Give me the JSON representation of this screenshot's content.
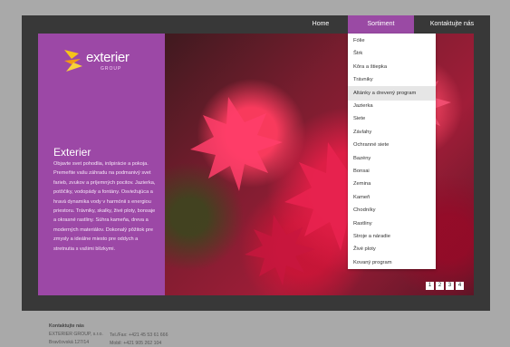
{
  "nav": {
    "home": "Home",
    "sortiment": "Sortiment",
    "kontakt": "Kontaktujte nás"
  },
  "logo": {
    "name": "exterier",
    "sub": "GROUP"
  },
  "panel": {
    "title": "Exterier",
    "body": "Objavte svet pohodlia, inšpirácie a pokoja. Premeňte vašu záhradu na podmanivý svet farieb, zvukov a príjemných pocitov. Jazierka, potôčiky, vodopády a fontány. Osviežujúca a hravá dynamika vody v harmónii s energiou priestoru. Trávniky, skalky, živé ploty, bonsaje a okrasné rastliny. Súhra kameňa, dreva a moderných materiálov. Dokonalý pôžitok pre zmysly a ideálne miesto pre oddych a stretnutia s vašimi blízkymi."
  },
  "dropdown": {
    "items": [
      "Fólie",
      "Štrk",
      "Kôra a štiepka",
      "Trávniky",
      "Altánky a drevený program",
      "Jazierka",
      "Siete",
      "Závlahy",
      "Ochranné siete",
      "Bazény",
      "Bonsai",
      "Zemina",
      "Kameň",
      "Chodníky",
      "Rastliny",
      "Stroje a náradie",
      "Živé ploty",
      "Kovaný program"
    ],
    "highlighted_index": 4
  },
  "slider": {
    "pages": [
      "1",
      "2",
      "3",
      "4"
    ]
  },
  "footer": {
    "title": "Kontaktujte nás",
    "company": "EXTERIER GROUP, s.r.o.",
    "address": "Bravčovská 127/14",
    "phone": "Tel./Fax: +421 45 53 61 666",
    "mobile": "Mobil: +421 905 262 104"
  },
  "colors": {
    "accent": "#9c48a6",
    "frame": "#383838",
    "background": "#a9a9a9"
  }
}
